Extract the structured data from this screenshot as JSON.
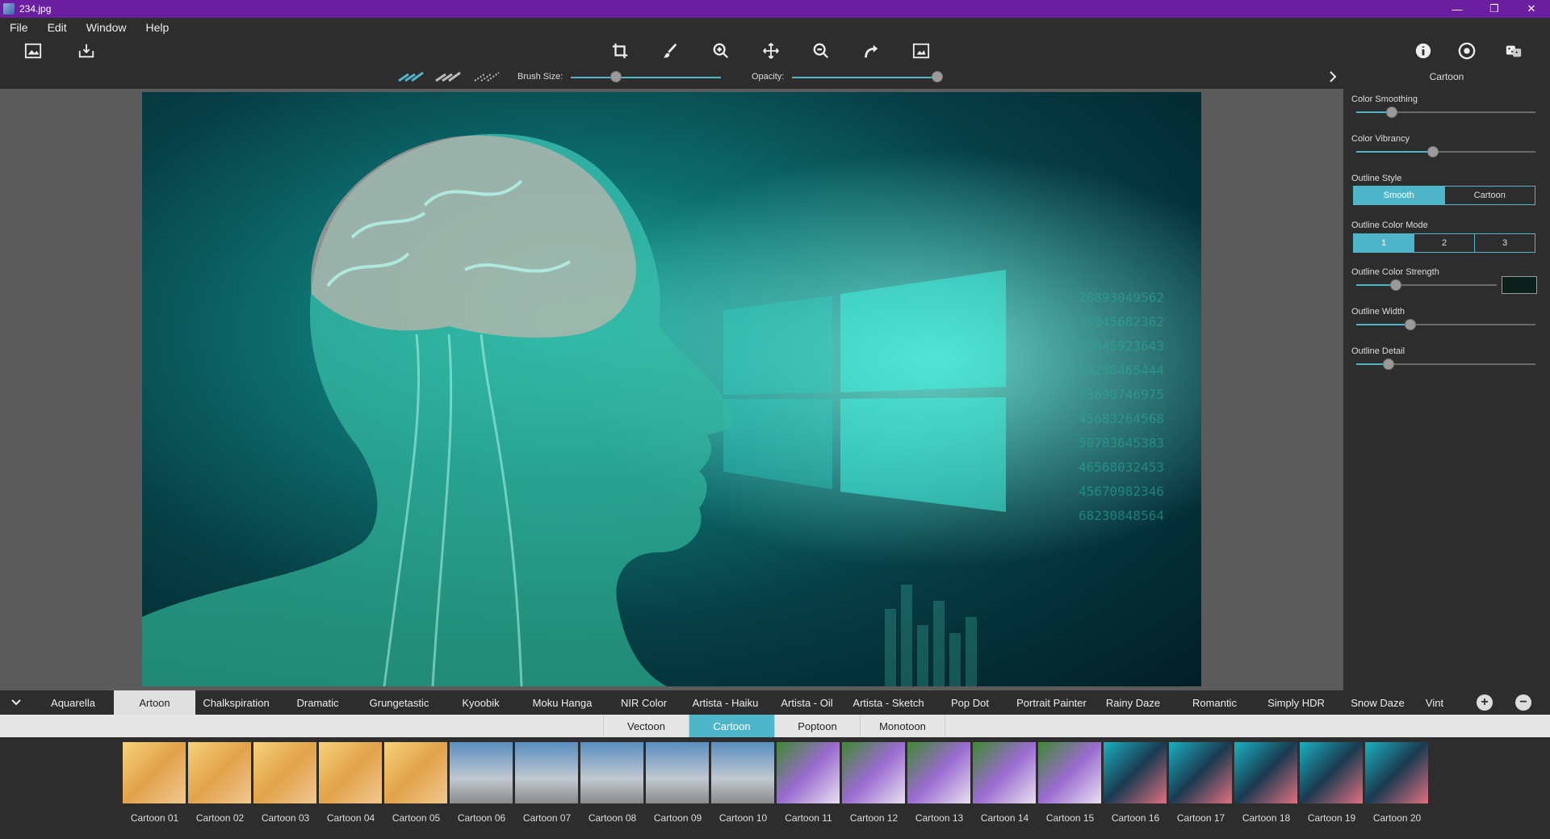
{
  "window": {
    "title": "234.jpg",
    "controls": [
      "—",
      "❐",
      "✕"
    ]
  },
  "menu": [
    "File",
    "Edit",
    "Window",
    "Help"
  ],
  "toolbar": {
    "left_icons": [
      "open-image-icon",
      "save-image-icon"
    ],
    "center_icons": [
      "crop-icon",
      "brush-icon",
      "zoom-in-icon",
      "move-icon",
      "zoom-out-icon",
      "redo-icon",
      "fit-screen-icon"
    ],
    "right_icons": [
      "info-icon",
      "settings-icon",
      "dice-icon"
    ]
  },
  "options": {
    "brush_size_label": "Brush Size:",
    "opacity_label": "Opacity:",
    "brush_size_value": 0.3,
    "opacity_value": 1.0
  },
  "right_panel": {
    "title": "Cartoon",
    "color_smoothing": {
      "label": "Color Smoothing",
      "value": 0.2
    },
    "color_vibrancy": {
      "label": "Color Vibrancy",
      "value": 0.43
    },
    "outline_style": {
      "label": "Outline Style",
      "options": [
        "Smooth",
        "Cartoon"
      ],
      "selected": 0
    },
    "outline_color_mode": {
      "label": "Outline Color Mode",
      "options": [
        "1",
        "2",
        "3"
      ],
      "selected": 0
    },
    "outline_color_strength": {
      "label": "Outline Color Strength",
      "value": 0.28,
      "swatch": "#0d1f1a"
    },
    "outline_width": {
      "label": "Outline Width",
      "value": 0.3
    },
    "outline_detail": {
      "label": "Outline Detail",
      "value": 0.18
    }
  },
  "categories": [
    "Aquarella",
    "Artoon",
    "Chalkspiration",
    "Dramatic",
    "Grungetastic",
    "Kyoobik",
    "Moku Hanga",
    "NIR Color",
    "Artista - Haiku",
    "Artista - Oil",
    "Artista - Sketch",
    "Pop Dot",
    "Portrait Painter",
    "Rainy Daze",
    "Romantic",
    "Simply HDR",
    "Snow Daze",
    "Vint"
  ],
  "active_category": 1,
  "subtabs": [
    "Vectoon",
    "Cartoon",
    "Poptoon",
    "Monotoon"
  ],
  "active_subtab": 1,
  "thumbnails": [
    "Cartoon 01",
    "Cartoon 02",
    "Cartoon 03",
    "Cartoon 04",
    "Cartoon 05",
    "Cartoon 06",
    "Cartoon 07",
    "Cartoon 08",
    "Cartoon 09",
    "Cartoon 10",
    "Cartoon 11",
    "Cartoon 12",
    "Cartoon 13",
    "Cartoon 14",
    "Cartoon 15",
    "Cartoon 16",
    "Cartoon 17",
    "Cartoon 18",
    "Cartoon 19",
    "Cartoon 20"
  ],
  "colors": {
    "accent": "#4fb5c9",
    "titlebar": "#6a1fa0",
    "panel": "#2d2d2d"
  }
}
